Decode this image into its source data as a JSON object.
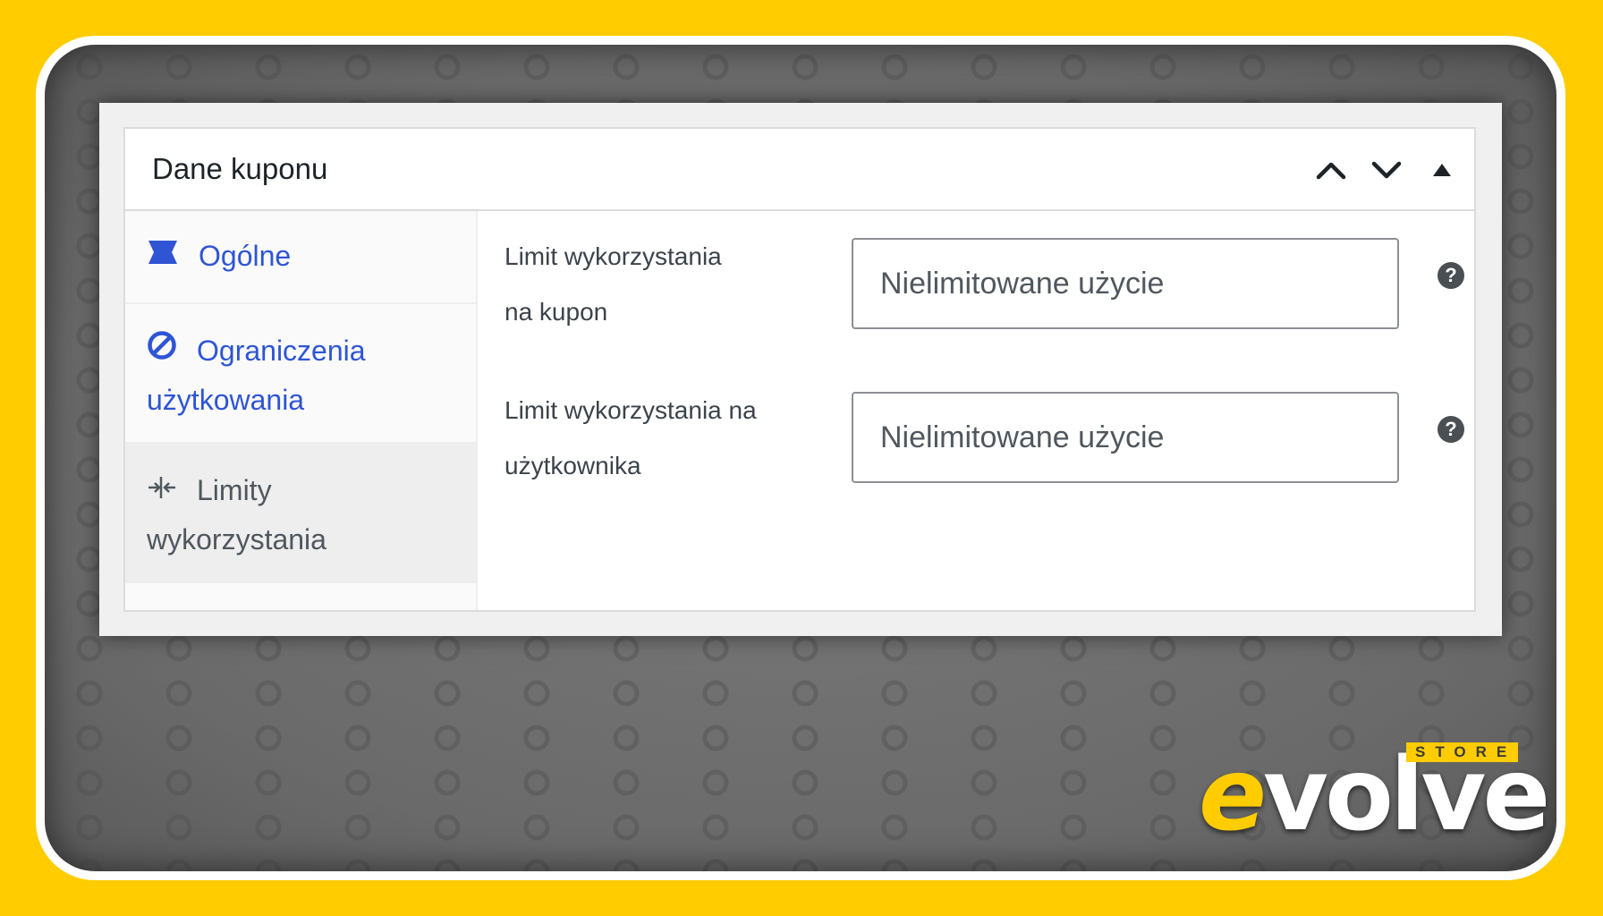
{
  "panel": {
    "title": "Dane kuponu",
    "actions": {
      "move_up_icon": "chevron-up-icon",
      "move_down_icon": "chevron-down-icon",
      "toggle_icon": "triangle-up-icon"
    }
  },
  "tabs": [
    {
      "label": "Ogólne",
      "icon": "ticket-icon",
      "active": false
    },
    {
      "label_line1": "Ograniczenia",
      "label_line2": "użytkowania",
      "icon": "prohibited-icon",
      "active": false
    },
    {
      "label_line1": "Limity",
      "label_line2": "wykorzystania",
      "icon": "limits-icon",
      "active": true
    }
  ],
  "fields": [
    {
      "label_line1": "Limit wykorzystania",
      "label_line2": "na kupon",
      "placeholder": "Nielimitowane użycie",
      "value": "",
      "help": "?"
    },
    {
      "label_line1": "Limit wykorzystania na",
      "label_line2": "użytkownika",
      "placeholder": "Nielimitowane użycie",
      "value": "",
      "help": "?"
    }
  ],
  "logo": {
    "main": "evolve",
    "first_letter": "e",
    "rest": "volve",
    "sub": "STORE"
  },
  "colors": {
    "background": "#FFCC00",
    "link": "#2f55d4",
    "active_tab_bg": "#eeeeee",
    "help_icon": "#4a4f54"
  }
}
